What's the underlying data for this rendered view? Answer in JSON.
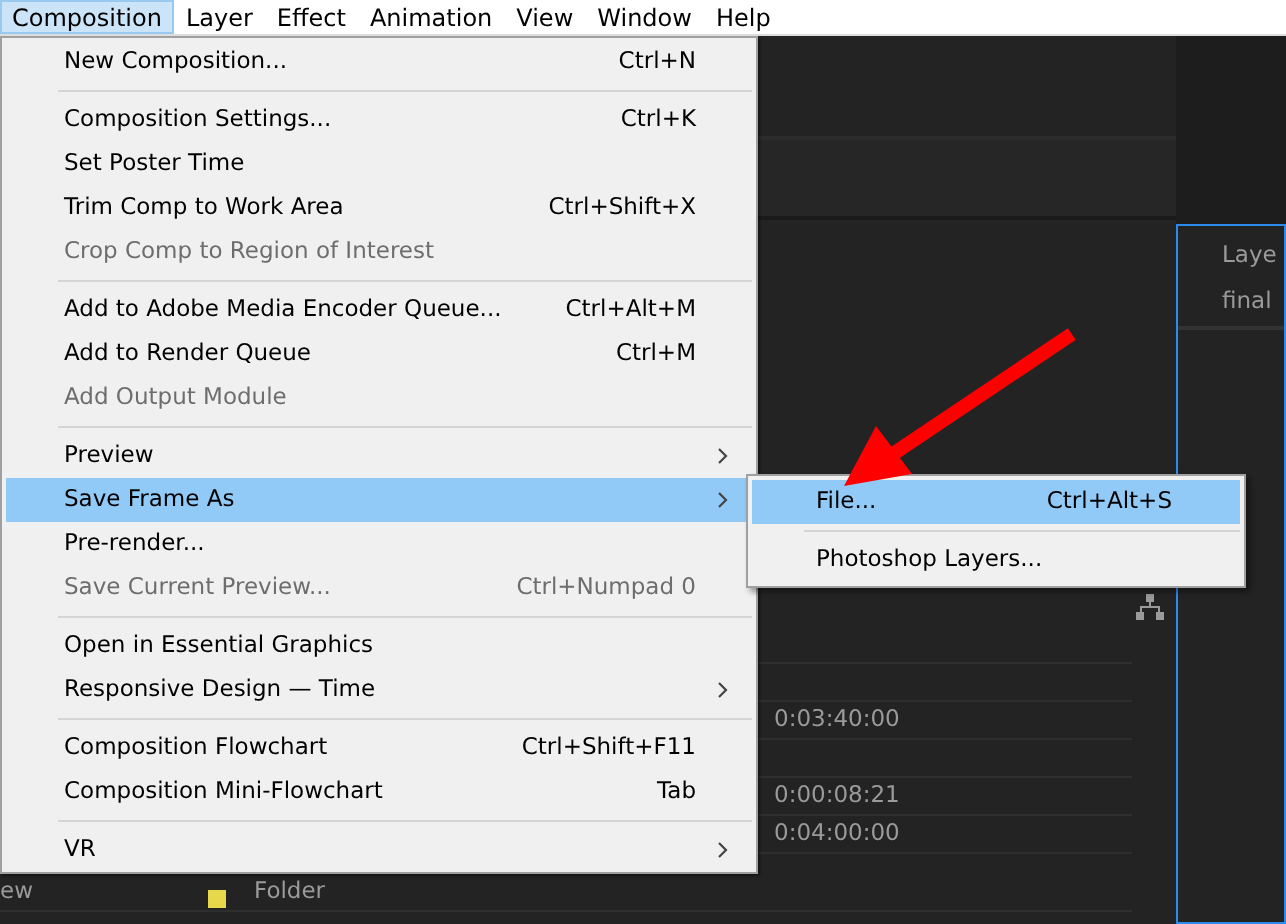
{
  "menubar": [
    {
      "label": "Composition",
      "selected": true
    },
    {
      "label": "Layer",
      "selected": false
    },
    {
      "label": "Effect",
      "selected": false
    },
    {
      "label": "Animation",
      "selected": false
    },
    {
      "label": "View",
      "selected": false
    },
    {
      "label": "Window",
      "selected": false
    },
    {
      "label": "Help",
      "selected": false
    }
  ],
  "menu": [
    {
      "kind": "item",
      "label": "New Composition...",
      "shortcut": "Ctrl+N",
      "disabled": false,
      "selected": false,
      "submenu": false
    },
    {
      "kind": "separator"
    },
    {
      "kind": "item",
      "label": "Composition Settings...",
      "shortcut": "Ctrl+K",
      "disabled": false,
      "selected": false,
      "submenu": false
    },
    {
      "kind": "item",
      "label": "Set Poster Time",
      "disabled": false,
      "selected": false,
      "submenu": false
    },
    {
      "kind": "item",
      "label": "Trim Comp to Work Area",
      "shortcut": "Ctrl+Shift+X",
      "disabled": false,
      "selected": false,
      "submenu": false
    },
    {
      "kind": "item",
      "label": "Crop Comp to Region of Interest",
      "disabled": true,
      "selected": false,
      "submenu": false
    },
    {
      "kind": "separator"
    },
    {
      "kind": "item",
      "label": "Add to Adobe Media Encoder Queue...",
      "shortcut": "Ctrl+Alt+M",
      "disabled": false,
      "selected": false,
      "submenu": false
    },
    {
      "kind": "item",
      "label": "Add to Render Queue",
      "shortcut": "Ctrl+M",
      "disabled": false,
      "selected": false,
      "submenu": false
    },
    {
      "kind": "item",
      "label": "Add Output Module",
      "disabled": true,
      "selected": false,
      "submenu": false
    },
    {
      "kind": "separator"
    },
    {
      "kind": "item",
      "label": "Preview",
      "disabled": false,
      "selected": false,
      "submenu": true
    },
    {
      "kind": "item",
      "label": "Save Frame As",
      "disabled": false,
      "selected": true,
      "submenu": true
    },
    {
      "kind": "item",
      "label": "Pre-render...",
      "disabled": false,
      "selected": false,
      "submenu": false
    },
    {
      "kind": "item",
      "label": "Save Current Preview...",
      "shortcut": "Ctrl+Numpad 0",
      "disabled": true,
      "selected": false,
      "submenu": false
    },
    {
      "kind": "separator"
    },
    {
      "kind": "item",
      "label": "Open in Essential Graphics",
      "disabled": false,
      "selected": false,
      "submenu": false
    },
    {
      "kind": "item",
      "label": "Responsive Design — Time",
      "disabled": false,
      "selected": false,
      "submenu": true
    },
    {
      "kind": "separator"
    },
    {
      "kind": "item",
      "label": "Composition Flowchart",
      "shortcut": "Ctrl+Shift+F11",
      "disabled": false,
      "selected": false,
      "submenu": false
    },
    {
      "kind": "item",
      "label": "Composition Mini-Flowchart",
      "shortcut": "Tab",
      "disabled": false,
      "selected": false,
      "submenu": false
    },
    {
      "kind": "separator"
    },
    {
      "kind": "item",
      "label": "VR",
      "disabled": false,
      "selected": false,
      "submenu": true
    }
  ],
  "submenu": [
    {
      "kind": "item",
      "label": "File...",
      "shortcut": "Ctrl+Alt+S",
      "selected": true
    },
    {
      "kind": "separator"
    },
    {
      "kind": "item",
      "label": "Photoshop Layers...",
      "selected": false
    }
  ],
  "right_panel": {
    "header": "Laye",
    "row": "final"
  },
  "project_rows": [
    {
      "kind": "blank"
    },
    {
      "kind": "blank"
    },
    {
      "kind": "time",
      "text": "0:03:40:00"
    },
    {
      "kind": "blank"
    },
    {
      "kind": "time",
      "text": "0:00:08:21"
    },
    {
      "kind": "time",
      "text": "0:04:00:00"
    },
    {
      "kind": "folder",
      "name": "ew",
      "text": "Folder",
      "color": "#e6d84a"
    }
  ]
}
